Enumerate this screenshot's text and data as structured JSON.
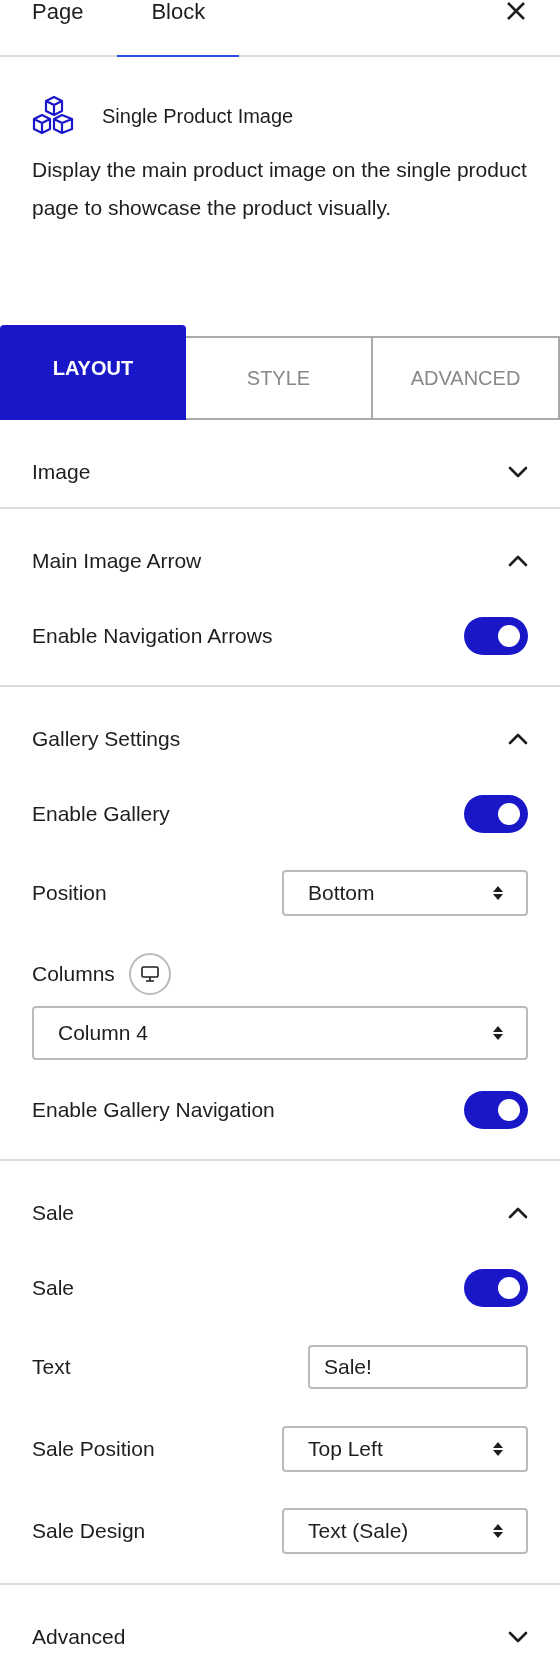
{
  "header_tabs": [
    {
      "label": "Page",
      "selected": false
    },
    {
      "label": "Block",
      "selected": true
    }
  ],
  "block": {
    "title": "Single Product Image",
    "description": "Display the main product image on the single product page to showcase the product visually."
  },
  "panel_tabs": [
    {
      "label": "LAYOUT",
      "selected": true
    },
    {
      "label": "STYLE",
      "selected": false
    },
    {
      "label": "ADVANCED",
      "selected": false
    }
  ],
  "sections": [
    {
      "title": "Image",
      "expanded": false
    },
    {
      "title": "Main Image Arrow",
      "expanded": true,
      "controls": [
        {
          "kind": "toggle",
          "label": "Enable Navigation Arrows",
          "on": true
        }
      ]
    },
    {
      "title": "Gallery Settings",
      "expanded": true,
      "controls": [
        {
          "kind": "toggle",
          "label": "Enable Gallery",
          "on": true
        },
        {
          "kind": "select",
          "label": "Position",
          "value": "Bottom"
        },
        {
          "kind": "responsive_select",
          "label": "Columns",
          "value": "Column 4"
        },
        {
          "kind": "toggle",
          "label": "Enable Gallery Navigation",
          "on": true
        }
      ]
    },
    {
      "title": "Sale",
      "expanded": true,
      "controls": [
        {
          "kind": "toggle",
          "label": "Sale",
          "on": true
        },
        {
          "kind": "text",
          "label": "Text",
          "value": "Sale!"
        },
        {
          "kind": "select",
          "label": "Sale Position",
          "value": "Top Left"
        },
        {
          "kind": "select",
          "label": "Sale Design",
          "value": "Text (Sale)"
        }
      ]
    },
    {
      "title": "Advanced",
      "expanded": false
    }
  ]
}
